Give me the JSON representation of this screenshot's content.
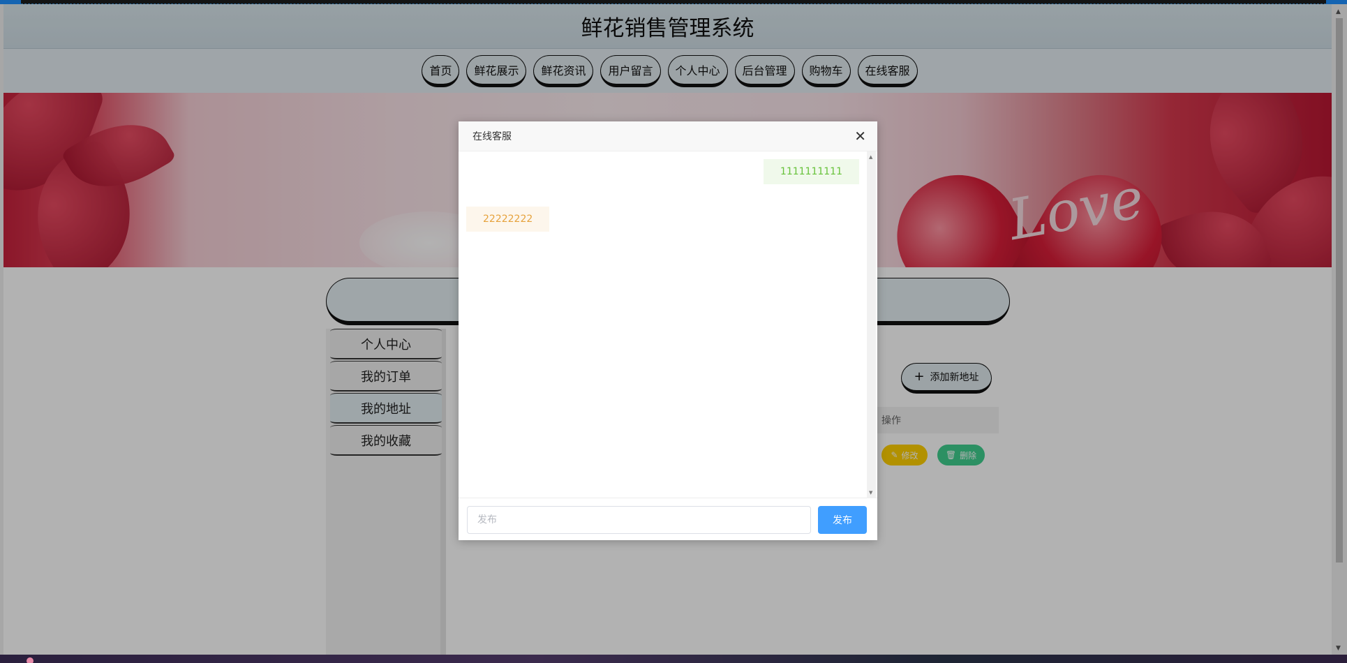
{
  "header": {
    "title": "鲜花销售管理系统"
  },
  "nav": {
    "items": [
      {
        "label": "首页"
      },
      {
        "label": "鲜花展示"
      },
      {
        "label": "鲜花资讯"
      },
      {
        "label": "用户留言"
      },
      {
        "label": "个人中心"
      },
      {
        "label": "后台管理"
      },
      {
        "label": "购物车"
      },
      {
        "label": "在线客服"
      }
    ]
  },
  "banner": {
    "text": "Love"
  },
  "sidebar": {
    "items": [
      {
        "label": "个人中心"
      },
      {
        "label": "我的订单"
      },
      {
        "label": "我的地址"
      },
      {
        "label": "我的收藏"
      }
    ],
    "active": "我的地址"
  },
  "main": {
    "add_button_label": "添加新地址",
    "table": {
      "column_action": "操作"
    },
    "edit_label": "修改",
    "delete_label": "删除"
  },
  "dialog": {
    "title": "在线客服",
    "messages": [
      {
        "side": "right",
        "text": "1111111111"
      },
      {
        "side": "left",
        "text": "22222222"
      }
    ],
    "input_placeholder": "发布",
    "publish_label": "发布"
  },
  "colors": {
    "accent_blue": "#409eff",
    "msg_right_bg": "#f0f9eb",
    "msg_right_text": "#67c23a",
    "msg_left_bg": "#fdf6ec",
    "msg_left_text": "#e6a23c",
    "edit_button": "#ffd000",
    "delete_button": "#3fcf8e"
  }
}
